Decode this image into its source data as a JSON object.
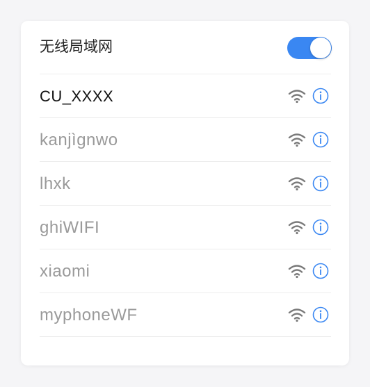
{
  "header": {
    "title": "无线局域网",
    "toggle_on": true
  },
  "colors": {
    "accent": "#3a87f2",
    "wifi_icon": "#7a7a7a",
    "connected_text": "#111111",
    "other_text": "#9a9a9a"
  },
  "networks": [
    {
      "name": "CU_XXXX",
      "connected": true,
      "signal_icon": "wifi-icon",
      "info_icon": "info-icon"
    },
    {
      "name": "kanjìgnwo",
      "connected": false,
      "signal_icon": "wifi-icon",
      "info_icon": "info-icon"
    },
    {
      "name": "lhxk",
      "connected": false,
      "signal_icon": "wifi-icon",
      "info_icon": "info-icon"
    },
    {
      "name": "ghiWIFI",
      "connected": false,
      "signal_icon": "wifi-icon",
      "info_icon": "info-icon"
    },
    {
      "name": "xiaomi",
      "connected": false,
      "signal_icon": "wifi-icon",
      "info_icon": "info-icon"
    },
    {
      "name": "myphoneWF",
      "connected": false,
      "signal_icon": "wifi-icon",
      "info_icon": "info-icon"
    }
  ]
}
